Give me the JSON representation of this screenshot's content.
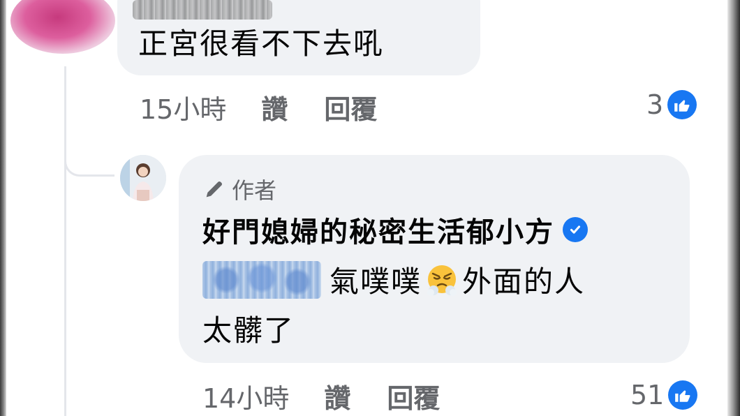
{
  "comment_1": {
    "text": "正宮很看不下去吼",
    "time": "15小時",
    "like_label": "讚",
    "reply_label": "回覆",
    "reaction_count": "3"
  },
  "comment_2": {
    "badge": "作者",
    "author": "好門媳婦的秘密生活郁小方",
    "text_line1": "氣噗噗",
    "text_line1_after_emoji": "外面的人",
    "text_line2": "太髒了",
    "time": "14小時",
    "like_label": "讚",
    "reply_label": "回覆",
    "reaction_count": "51"
  },
  "icons": {
    "like": "thumbs-up-icon",
    "verified": "verified-badge-icon",
    "author_badge": "pen-icon",
    "emoji": "huffing-face-emoji"
  },
  "colors": {
    "accent": "#1877f2",
    "bubble": "#f0f2f5",
    "meta_text": "#65676b"
  }
}
